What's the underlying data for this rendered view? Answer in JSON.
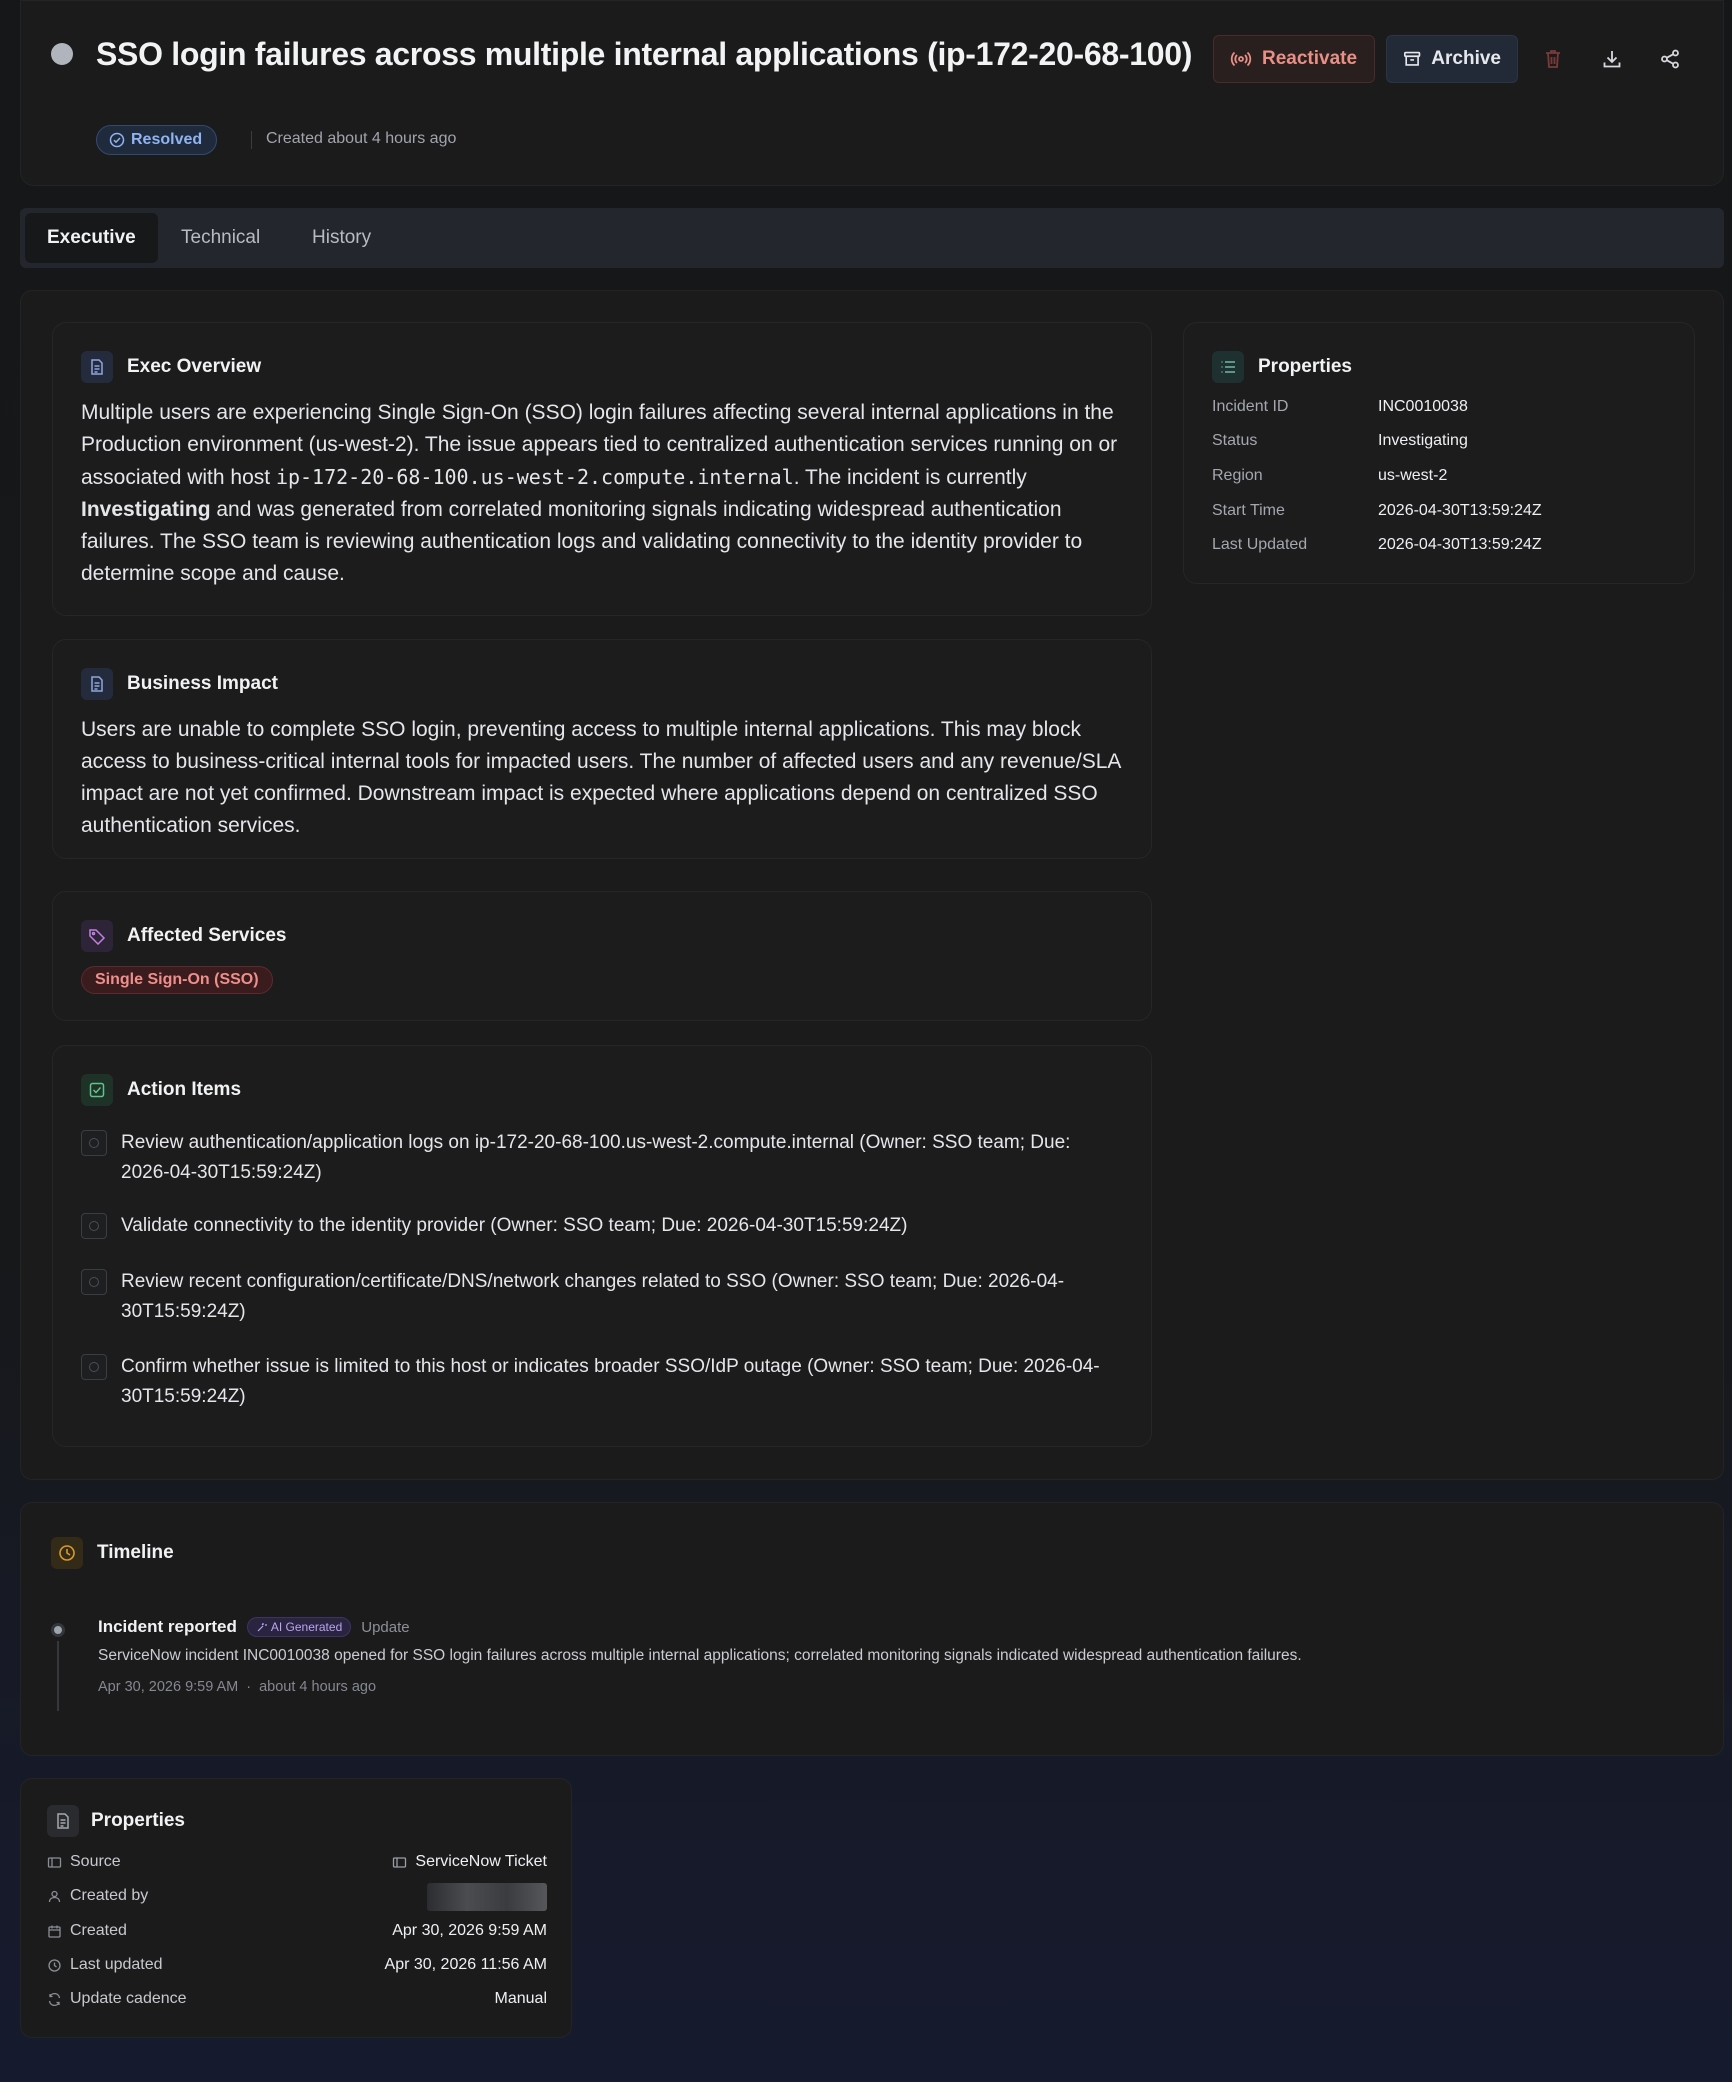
{
  "header": {
    "title": "SSO login failures across multiple internal applications (ip-172-20-68-100)",
    "status_badge": "Resolved",
    "created": "Created about 4 hours ago",
    "reactivate_label": "Reactivate",
    "archive_label": "Archive"
  },
  "tabs": [
    {
      "label": "Executive"
    },
    {
      "label": "Technical"
    },
    {
      "label": "History"
    }
  ],
  "exec_overview": {
    "title": "Exec Overview",
    "text_1": "Multiple users are experiencing Single Sign-On (SSO) login failures affecting several internal applications in the Production environment (us-west-2). The issue appears tied to centralized authentication services running on or associated with host ",
    "host": "ip-172-20-68-100.us-west-2.compute.internal",
    "text_2": ". The incident is currently ",
    "status_word": "Investigating",
    "text_3": " and was generated from correlated monitoring signals indicating widespread authentication failures. The SSO team is reviewing authentication logs and validating connectivity to the identity provider to determine scope and cause."
  },
  "business_impact": {
    "title": "Business Impact",
    "text": "Users are unable to complete SSO login, preventing access to multiple internal applications. This may block access to business-critical internal tools for impacted users. The number of affected users and any revenue/SLA impact are not yet confirmed. Downstream impact is expected where applications depend on centralized SSO authentication services."
  },
  "affected_services": {
    "title": "Affected Services",
    "items": [
      "Single Sign-On (SSO)"
    ]
  },
  "action_items": {
    "title": "Action Items",
    "items": [
      "Review authentication/application logs on ip-172-20-68-100.us-west-2.compute.internal (Owner: SSO team; Due: 2026-04-30T15:59:24Z)",
      "Validate connectivity to the identity provider (Owner: SSO team; Due: 2026-04-30T15:59:24Z)",
      "Review recent configuration/certificate/DNS/network changes related to SSO (Owner: SSO team; Due: 2026-04-30T15:59:24Z)",
      "Confirm whether issue is limited to this host or indicates broader SSO/IdP outage (Owner: SSO team; Due: 2026-04-30T15:59:24Z)"
    ]
  },
  "properties": {
    "title": "Properties",
    "rows": [
      {
        "key": "Incident ID",
        "value": "INC0010038"
      },
      {
        "key": "Status",
        "value": "Investigating"
      },
      {
        "key": "Region",
        "value": "us-west-2"
      },
      {
        "key": "Start Time",
        "value": "2026-04-30T13:59:24Z"
      },
      {
        "key": "Last Updated",
        "value": "2026-04-30T13:59:24Z"
      }
    ]
  },
  "timeline": {
    "title": "Timeline",
    "entries": [
      {
        "title": "Incident reported",
        "badge": "AI Generated",
        "kind": "Update",
        "text": "ServiceNow incident INC0010038 opened for SSO login failures across multiple internal applications; correlated monitoring signals indicated widespread authentication failures.",
        "date": "Apr 30, 2026 9:59 AM",
        "relative": "about 4 hours ago"
      }
    ]
  },
  "properties_panel": {
    "title": "Properties",
    "source_key": "Source",
    "source_value": "ServiceNow Ticket",
    "created_by_key": "Created by",
    "created_key": "Created",
    "created_value": "Apr 30, 2026 9:59 AM",
    "last_updated_key": "Last updated",
    "last_updated_value": "Apr 30, 2026 11:56 AM",
    "cadence_key": "Update cadence",
    "cadence_value": "Manual"
  },
  "colors": {
    "accent_blue": "#8fb4f0",
    "danger": "#e88f86",
    "timeline_icon": "#d99a2b",
    "ai_badge": "#a98ff0"
  }
}
